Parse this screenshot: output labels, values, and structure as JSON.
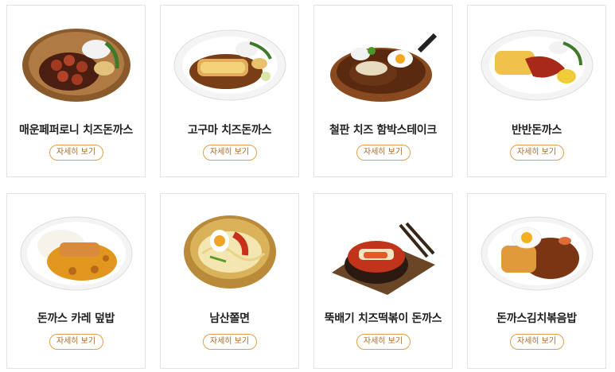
{
  "menu": {
    "detail_label": "자세히 보기",
    "items": [
      {
        "name": "매운페퍼로니 치즈돈까스",
        "icon": "pepperoni-cutlet-dish-icon"
      },
      {
        "name": "고구마 치즈돈까스",
        "icon": "sweet-potato-cutlet-dish-icon"
      },
      {
        "name": "철판 치즈 함박스테이크",
        "icon": "hamburg-steak-sizzling-plate-icon"
      },
      {
        "name": "반반돈까스",
        "icon": "half-half-cutlet-dish-icon"
      },
      {
        "name": "돈까스 카레 덮밥",
        "icon": "cutlet-curry-rice-icon"
      },
      {
        "name": "남산쫄면",
        "icon": "cold-noodle-bowl-icon"
      },
      {
        "name": "뚝배기 치즈떡볶이 돈까스",
        "icon": "earthenware-tteokbokki-icon"
      },
      {
        "name": "돈까스김치볶음밥",
        "icon": "kimchi-fried-rice-cutlet-icon"
      }
    ]
  },
  "colors": {
    "button_border": "#e0a04a",
    "button_text": "#a8692a",
    "card_border": "#e3e3e3"
  }
}
